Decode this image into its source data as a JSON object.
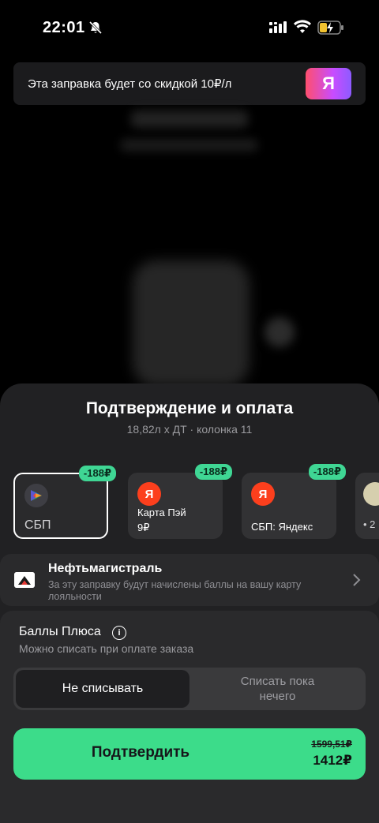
{
  "status_bar": {
    "time": "22:01"
  },
  "promo": {
    "text": "Эта заправка будет со скидкой 10₽/л",
    "logo": "Я"
  },
  "sheet": {
    "title": "Подтверждение и оплата",
    "subtitle": "18,82л х ДТ · колонка 11"
  },
  "payment_methods": [
    {
      "label": "СБП",
      "badge": "-188₽",
      "icon": "sbp-icon",
      "selected": true
    },
    {
      "label": "Карта Пэй",
      "amount": "9₽",
      "badge": "-188₽",
      "icon": "yandex-icon"
    },
    {
      "label": "СБП: Яндекс",
      "badge": "-188₽",
      "icon": "yandex-icon"
    },
    {
      "amount": "• 2",
      "icon": "coin-icon"
    }
  ],
  "loyalty": {
    "title": "Нефтьмагистраль",
    "description": "За эту заправку будут начислены баллы на вашу карту лояльности"
  },
  "plus_points": {
    "title": "Баллы Плюса",
    "subtitle": "Можно списать при оплате заказа",
    "option_selected": "Не списывать",
    "option_other": "Списать пока нечего"
  },
  "confirm": {
    "label": "Подтвердить",
    "old_price": "1599,51₽",
    "new_price": "1412₽"
  },
  "colors": {
    "accent": "#3cdc8a",
    "badge": "#3fd694",
    "sheet": "#212123"
  }
}
